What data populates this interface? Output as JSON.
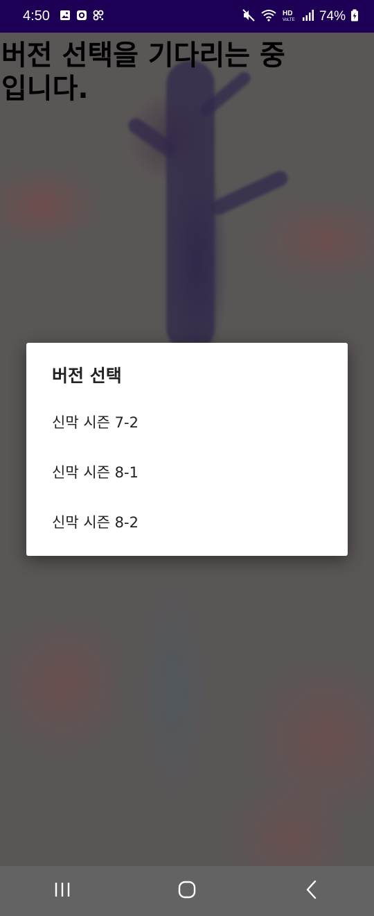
{
  "status_bar": {
    "time": "4:50",
    "battery_percent": "74%",
    "left_icons": [
      "gallery-icon",
      "notification-app-icon",
      "qr-code-icon"
    ],
    "right_icons": [
      "mute-icon",
      "wifi-icon",
      "hd-voice-icon",
      "signal-icon",
      "battery-charging-icon"
    ]
  },
  "main": {
    "waiting_message": "버전 선택을 기다리는 중입니다."
  },
  "dialog": {
    "title": "버전 선택",
    "options": [
      {
        "label": "신막 시즌 7-2"
      },
      {
        "label": "신막 시즌 8-1"
      },
      {
        "label": "신막 시즌 8-2"
      }
    ]
  },
  "nav_bar": {
    "buttons": [
      "recent-apps-icon",
      "home-icon",
      "back-icon"
    ]
  },
  "colors": {
    "status_bar_bg": "#1d0055",
    "dialog_bg": "#ffffff",
    "nav_bar_bg": "#636363",
    "text_dark": "#212121"
  }
}
